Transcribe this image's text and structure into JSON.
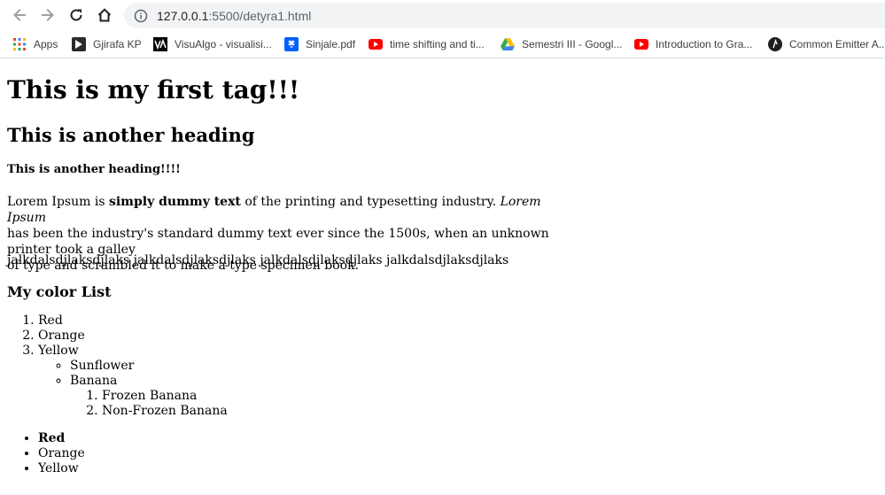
{
  "browser": {
    "url_host": "127.0.0.1",
    "url_path": ":5500/detyra1.html",
    "bookmarks": [
      {
        "label": "Apps",
        "icon": "apps-grid-icon"
      },
      {
        "label": "Gjirafa KP",
        "icon": "gjirafa-icon"
      },
      {
        "label": "VisuAlgo - visualisi...",
        "icon": "visualgo-icon"
      },
      {
        "label": "Sinjale.pdf",
        "icon": "dropbox-icon"
      },
      {
        "label": "time shifting and ti...",
        "icon": "youtube-icon"
      },
      {
        "label": "Semestri III - Googl...",
        "icon": "google-drive-icon"
      },
      {
        "label": "Introduction to Gra...",
        "icon": "youtube-icon"
      },
      {
        "label": "Common Emitter A...",
        "icon": "generic-site-icon"
      }
    ]
  },
  "page": {
    "h1": "This is my first tag!!!",
    "h2": "This is another heading",
    "h4": "This is another heading!!!!",
    "lorem": {
      "part1": "Lorem Ipsum is ",
      "bold": "simply dummy text",
      "part2": " of the printing and typesetting industry. ",
      "italic": "Lorem Ipsum",
      "line2": "has been the industry's standard dummy text ever since the 1500s, when an unknown printer took a galley",
      "line3": "of type and scrambled it to make a type specimen book."
    },
    "jalk": "jalkdalsdjlaksdjlaks jalkdalsdjlaksdjlaks jalkdalsdjlaksdjlaks jalkdalsdjlaksdjlaks",
    "list_heading": "My color List",
    "ordered": {
      "item1": "Red",
      "item2": "Orange",
      "item3": "Yellow",
      "sub": {
        "item1": "Sunflower",
        "item2": "Banana",
        "subsub": {
          "item1": "Frozen Banana",
          "item2": "Non-Frozen Banana"
        }
      }
    },
    "unordered": {
      "item1": "Red",
      "item2": "Orange",
      "item3": "Yellow"
    }
  },
  "colors": {
    "toolbar_bg": "#ffffff",
    "omnibox_bg": "#f1f3f4",
    "icon_gray": "#5f6368",
    "youtube_red": "#ff0000"
  }
}
